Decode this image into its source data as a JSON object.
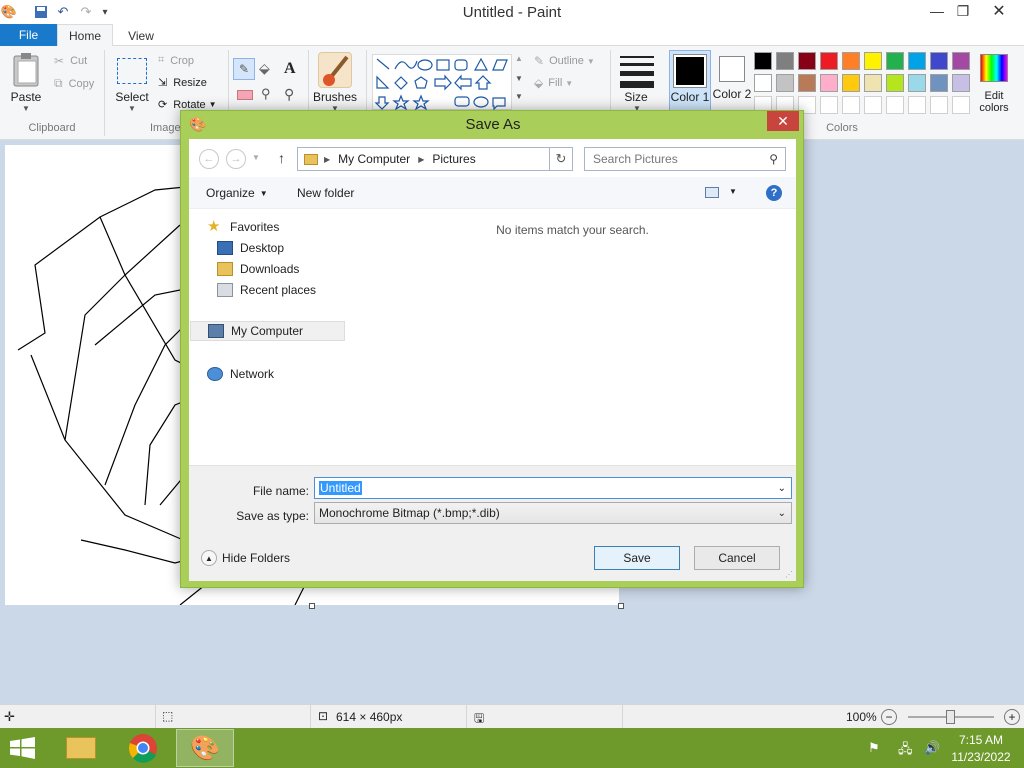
{
  "window": {
    "title": "Untitled - Paint"
  },
  "tabs": {
    "file": "File",
    "home": "Home",
    "view": "View"
  },
  "ribbon": {
    "clipboard": {
      "paste": "Paste",
      "cut": "Cut",
      "copy": "Copy",
      "label": "Clipboard"
    },
    "image": {
      "select": "Select",
      "crop": "Crop",
      "resize": "Resize",
      "rotate": "Rotate",
      "label": "Image"
    },
    "brushes": "Brushes",
    "shapes": {
      "outline": "Outline",
      "fill": "Fill"
    },
    "size": "Size",
    "color1": "Color 1",
    "color2": "Color 2",
    "edit_colors": "Edit colors",
    "colors_label": "Colors",
    "palette_row1": [
      "#000000",
      "#7f7f7f",
      "#880015",
      "#ed1c24",
      "#ff7f27",
      "#fff200",
      "#22b14c",
      "#00a2e8",
      "#3f48cc",
      "#a349a4"
    ],
    "palette_row2": [
      "#ffffff",
      "#c3c3c3",
      "#b97a57",
      "#ffaec9",
      "#ffc90e",
      "#efe4b0",
      "#b5e61d",
      "#99d9ea",
      "#7092be",
      "#c8bfe7"
    ]
  },
  "dialog": {
    "title": "Save As",
    "breadcrumb": [
      "My Computer",
      "Pictures"
    ],
    "search_placeholder": "Search Pictures",
    "organize": "Organize",
    "new_folder": "New folder",
    "empty_message": "No items match your search.",
    "tree": {
      "favorites": "Favorites",
      "desktop": "Desktop",
      "downloads": "Downloads",
      "recent": "Recent places",
      "computer": "My Computer",
      "network": "Network"
    },
    "file_name_label": "File name:",
    "file_name_value": "Untitled",
    "save_type_label": "Save as type:",
    "save_type_value": "Monochrome Bitmap (*.bmp;*.dib)",
    "hide_folders": "Hide Folders",
    "save": "Save",
    "cancel": "Cancel"
  },
  "status": {
    "dimensions": "614 × 460px",
    "zoom": "100%"
  },
  "taskbar": {
    "time": "7:15 AM",
    "date": "11/23/2022"
  }
}
